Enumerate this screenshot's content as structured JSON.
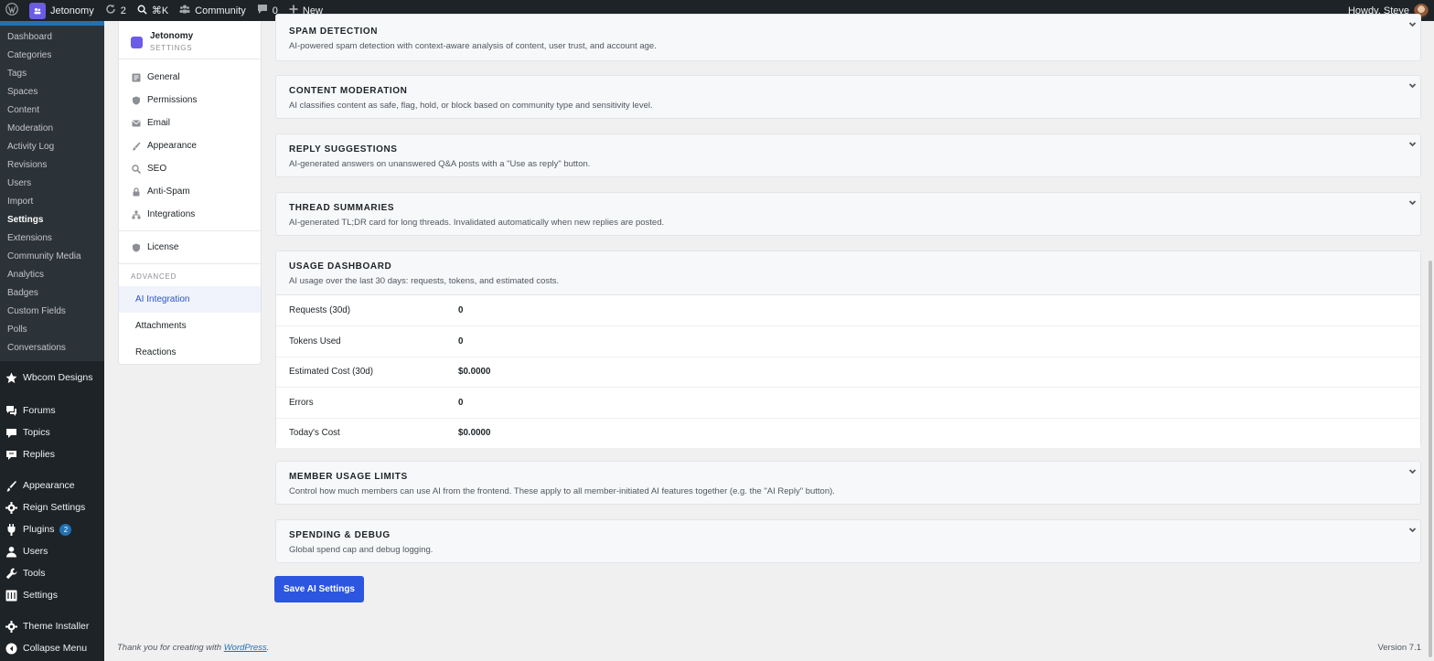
{
  "admin_bar": {
    "site_name": "Jetonomy",
    "updates_count": "2",
    "search_shortcut": "⌘K",
    "community_label": "Community",
    "comments_count": "0",
    "new_label": "New",
    "howdy": "Howdy, Steve"
  },
  "sidebar": {
    "submenu": [
      "Dashboard",
      "Categories",
      "Tags",
      "Spaces",
      "Content",
      "Moderation",
      "Activity Log",
      "Revisions",
      "Users",
      "Import",
      "Settings",
      "Extensions",
      "Community Media",
      "Analytics",
      "Badges",
      "Custom Fields",
      "Polls",
      "Conversations"
    ],
    "current_submenu": "Settings",
    "menu": [
      {
        "label": "Wbcom Designs",
        "icon": "star-icon"
      },
      {
        "label": "Forums",
        "icon": "forums-icon"
      },
      {
        "label": "Topics",
        "icon": "topics-icon"
      },
      {
        "label": "Replies",
        "icon": "replies-icon"
      },
      {
        "label": "Appearance",
        "icon": "brush-icon"
      },
      {
        "label": "Reign Settings",
        "icon": "gear-icon"
      },
      {
        "label": "Plugins",
        "icon": "plugin-icon",
        "badge": "2"
      },
      {
        "label": "Users",
        "icon": "user-icon"
      },
      {
        "label": "Tools",
        "icon": "wrench-icon"
      },
      {
        "label": "Settings",
        "icon": "sliders-icon"
      },
      {
        "label": "Theme Installer",
        "icon": "gear-icon"
      },
      {
        "label": "Collapse Menu",
        "icon": "collapse-icon"
      }
    ]
  },
  "settings_nav": {
    "brand_title": "Jetonomy",
    "brand_subtitle": "SETTINGS",
    "items": [
      {
        "label": "General",
        "icon": "general-icon"
      },
      {
        "label": "Permissions",
        "icon": "shield-icon"
      },
      {
        "label": "Email",
        "icon": "mail-icon"
      },
      {
        "label": "Appearance",
        "icon": "brush-icon"
      },
      {
        "label": "SEO",
        "icon": "search-icon"
      },
      {
        "label": "Anti-Spam",
        "icon": "lock-icon"
      },
      {
        "label": "Integrations",
        "icon": "network-icon"
      }
    ],
    "license_label": "License",
    "advanced_heading": "ADVANCED",
    "advanced_items": [
      "AI Integration",
      "Attachments",
      "Reactions"
    ],
    "active_item": "AI Integration"
  },
  "sections": [
    {
      "title": "SPAM DETECTION",
      "desc": "AI-powered spam detection with context-aware analysis of content, user trust, and account age."
    },
    {
      "title": "CONTENT MODERATION",
      "desc": "AI classifies content as safe, flag, hold, or block based on community type and sensitivity level."
    },
    {
      "title": "REPLY SUGGESTIONS",
      "desc": "AI-generated answers on unanswered Q&A posts with a \"Use as reply\" button."
    },
    {
      "title": "THREAD SUMMARIES",
      "desc": "AI-generated TL;DR card for long threads. Invalidated automatically when new replies are posted."
    }
  ],
  "usage": {
    "title": "USAGE DASHBOARD",
    "desc": "AI usage over the last 30 days: requests, tokens, and estimated costs.",
    "rows": [
      {
        "label": "Requests (30d)",
        "value": "0"
      },
      {
        "label": "Tokens Used",
        "value": "0"
      },
      {
        "label": "Estimated Cost (30d)",
        "value": "$0.0000"
      },
      {
        "label": "Errors",
        "value": "0"
      },
      {
        "label": "Today's Cost",
        "value": "$0.0000"
      }
    ]
  },
  "sections_after": [
    {
      "title": "MEMBER USAGE LIMITS",
      "desc": "Control how much members can use AI from the frontend. These apply to all member-initiated AI features together (e.g. the \"AI Reply\" button)."
    },
    {
      "title": "SPENDING & DEBUG",
      "desc": "Global spend cap and debug logging."
    }
  ],
  "save_label": "Save AI Settings",
  "footer": {
    "thanks_prefix": "Thank you for creating with ",
    "wordpress_link": "WordPress",
    "thanks_suffix": ".",
    "version": "Version 7.1"
  },
  "colors": {
    "admin_dark": "#1d2327",
    "accent": "#2c55e0",
    "brand": "#6b5ce7",
    "link": "#2271b1"
  }
}
